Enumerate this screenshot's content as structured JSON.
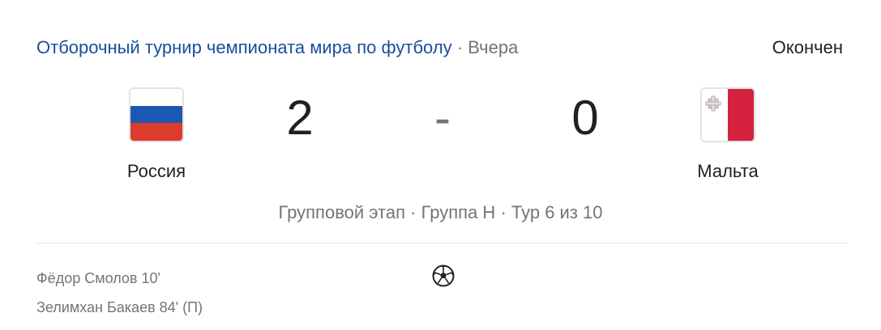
{
  "header": {
    "tournament": "Отборочный турнир чемпионата мира по футболу",
    "separator": "·",
    "date": "Вчера",
    "status": "Окончен"
  },
  "match": {
    "home": {
      "name": "Россия",
      "score": "2",
      "flag_colors": [
        "#ffffff",
        "#0039a6",
        "#d52b1e"
      ]
    },
    "away": {
      "name": "Мальта",
      "score": "0",
      "flag_colors": [
        "#ffffff",
        "#cf142b"
      ]
    },
    "dash": "-"
  },
  "stage": {
    "phase": "Групповой этап",
    "group": "Группа H",
    "round": "Тур 6 из 10",
    "separator": "·"
  },
  "scorers": [
    "Фёдор Смолов 10'",
    "Зелимхан Бакаев 84' (П)"
  ],
  "icons": {
    "goal": "soccer-ball-icon"
  }
}
